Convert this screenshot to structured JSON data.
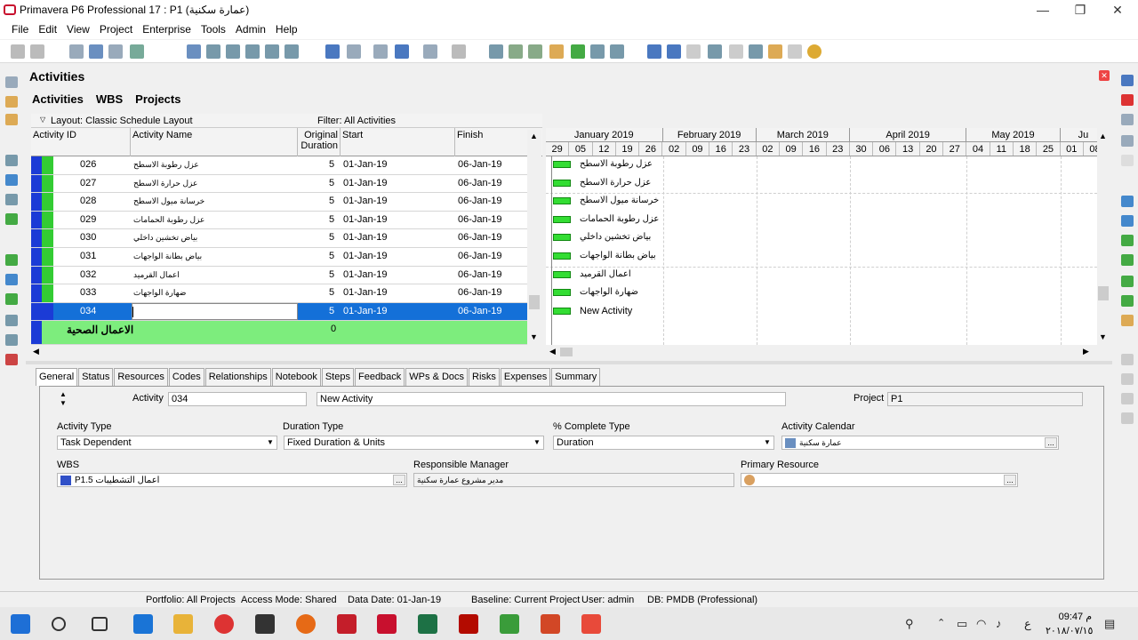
{
  "window": {
    "title": "Primavera P6 Professional 17 : P1 (عمارة سكنية)"
  },
  "menu": [
    "File",
    "Edit",
    "View",
    "Project",
    "Enterprise",
    "Tools",
    "Admin",
    "Help"
  ],
  "panel": {
    "title": "Activities",
    "tabs": [
      "Activities",
      "WBS",
      "Projects"
    ]
  },
  "layout_bar": {
    "layout": "Layout: Classic Schedule Layout",
    "filter": "Filter: All Activities"
  },
  "table": {
    "columns": {
      "id": "Activity ID",
      "name": "Activity Name",
      "duration": "Original\nDuration",
      "start": "Start",
      "finish": "Finish"
    },
    "rows": [
      {
        "id": "026",
        "name": "عزل رطوبة الاسطح",
        "duration": "5",
        "start": "01-Jan-19",
        "finish": "06-Jan-19"
      },
      {
        "id": "027",
        "name": "عزل حرارة الاسطح",
        "duration": "5",
        "start": "01-Jan-19",
        "finish": "06-Jan-19"
      },
      {
        "id": "028",
        "name": "خرسانة ميول الاسطح",
        "duration": "5",
        "start": "01-Jan-19",
        "finish": "06-Jan-19"
      },
      {
        "id": "029",
        "name": "عزل رطوبة الحمامات",
        "duration": "5",
        "start": "01-Jan-19",
        "finish": "06-Jan-19"
      },
      {
        "id": "030",
        "name": "بياض تخشين داخلي",
        "duration": "5",
        "start": "01-Jan-19",
        "finish": "06-Jan-19"
      },
      {
        "id": "031",
        "name": "بياض بطانة الواجهات",
        "duration": "5",
        "start": "01-Jan-19",
        "finish": "06-Jan-19"
      },
      {
        "id": "032",
        "name": "اعمال القرميد",
        "duration": "5",
        "start": "01-Jan-19",
        "finish": "06-Jan-19"
      },
      {
        "id": "033",
        "name": "ضهارة الواجهات",
        "duration": "5",
        "start": "01-Jan-19",
        "finish": "06-Jan-19"
      },
      {
        "id": "034",
        "name": "",
        "duration": "5",
        "start": "01-Jan-19",
        "finish": "06-Jan-19"
      }
    ],
    "group_row": {
      "name": "الاعمال الصحية",
      "duration": "0"
    }
  },
  "gantt": {
    "months": [
      "January 2019",
      "February 2019",
      "March 2019",
      "April 2019",
      "May 2019",
      "Ju"
    ],
    "weeks": [
      "29",
      "05",
      "12",
      "19",
      "26",
      "02",
      "09",
      "16",
      "23",
      "02",
      "09",
      "16",
      "23",
      "30",
      "06",
      "13",
      "20",
      "27",
      "04",
      "11",
      "18",
      "25",
      "01",
      "08"
    ],
    "labels": [
      "عزل رطوبة الاسطح",
      "عزل حرارة الاسطح",
      "خرسانة ميول الاسطح",
      "عزل رطوبة الحمامات",
      "بياض تخشين داخلي",
      "بياض بطانة الواجهات",
      "اعمال القرميد",
      "ضهارة الواجهات",
      "New Activity"
    ]
  },
  "detail_tabs": [
    "General",
    "Status",
    "Resources",
    "Codes",
    "Relationships",
    "Notebook",
    "Steps",
    "Feedback",
    "WPs & Docs",
    "Risks",
    "Expenses",
    "Summary"
  ],
  "general": {
    "activity_label": "Activity",
    "activity_id": "034",
    "activity_name": "New Activity",
    "project_label": "Project",
    "project_value": "P1",
    "activity_type_label": "Activity Type",
    "activity_type": "Task Dependent",
    "duration_type_label": "Duration Type",
    "duration_type": "Fixed Duration & Units",
    "pct_type_label": "% Complete Type",
    "pct_type": "Duration",
    "calendar_label": "Activity Calendar",
    "calendar": "عمارة سكنية",
    "wbs_label": "WBS",
    "wbs": "P1.5  اعمال التشطيبات",
    "manager_label": "Responsible Manager",
    "manager": "مدير مشروع عمارة سكنية",
    "primary_resource_label": "Primary Resource",
    "primary_resource": ""
  },
  "status_bar": {
    "portfolio": "Portfolio: All Projects",
    "access": "Access Mode: Shared",
    "data_date": "Data Date: 01-Jan-19",
    "baseline": "Baseline: Current Project",
    "user": "User: admin",
    "db": "DB: PMDB (Professional)"
  },
  "taskbar": {
    "time": "09:47 م",
    "date": "٢٠١٨/٠٧/١٥",
    "lang": "ع"
  }
}
